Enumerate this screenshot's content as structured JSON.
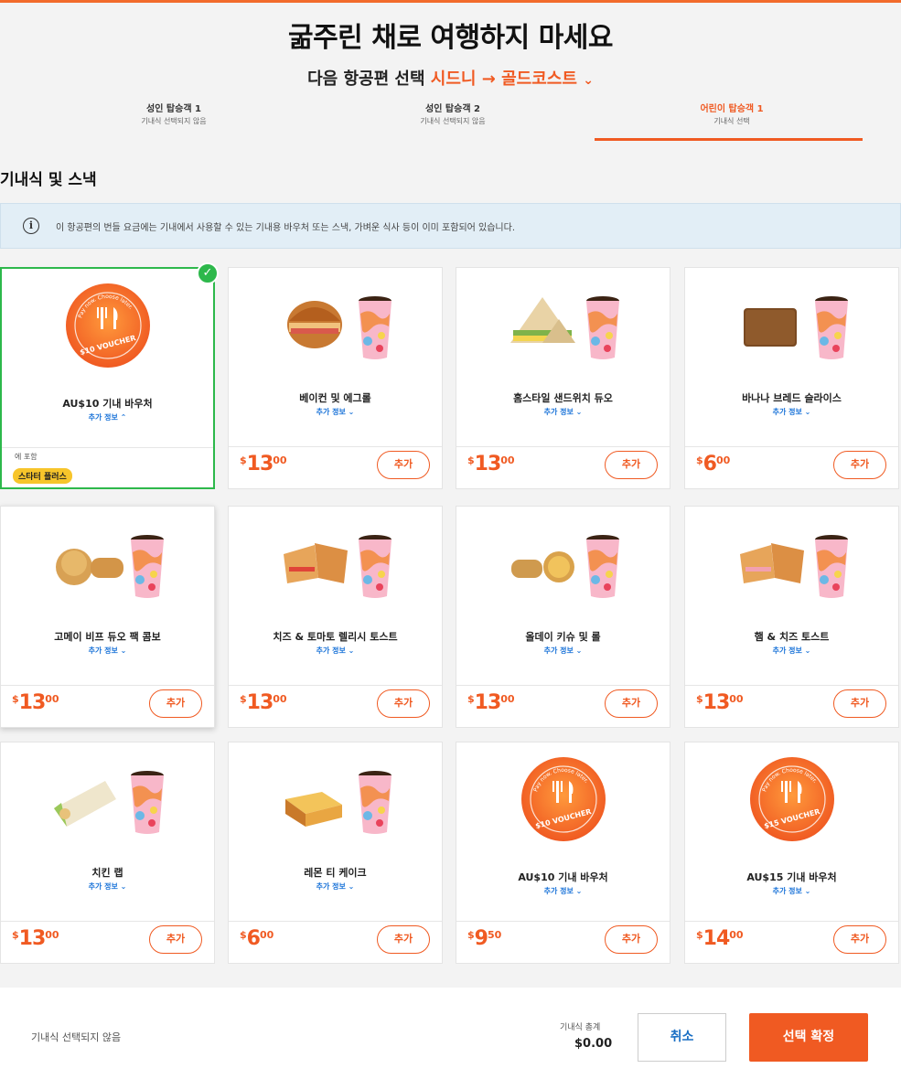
{
  "header": {
    "headline": "굶주린 채로 여행하지 마세요",
    "subhead_prefix": "다음 항공편 선택",
    "route": "시드니 → 골드코스트",
    "route_chevron": "⌄"
  },
  "passengers": [
    {
      "name": "성인 탑승객 1",
      "status": "기내식 선택되지 않음",
      "active": false
    },
    {
      "name": "성인 탑승객 2",
      "status": "기내식 선택되지 않음",
      "active": false
    },
    {
      "name": "어린이 탑승객 1",
      "status": "기내식 선택",
      "active": true
    }
  ],
  "section_title": "기내식 및 스낵",
  "info_bar": {
    "icon": "info-icon",
    "text": "이 항공편의 번들 요금에는 기내에서 사용할 수 있는 기내용 바우처 또는 스낵, 가벼운 식사 등이 이미 포함되어 있습니다."
  },
  "more_info_label": "추가 정보",
  "add_label": "추가",
  "items": [
    {
      "name": "AU$10 기내 바우처",
      "image": "voucher-10",
      "included_label": "에 포함",
      "badge": "스타터 플러스",
      "selected": true
    },
    {
      "name": "베이컨 및 에그롤",
      "image": "bacon-egg-roll",
      "price_cur": "$",
      "price_int": "13",
      "price_dec": "00"
    },
    {
      "name": "홈스타일 샌드위치 듀오",
      "image": "sandwich",
      "price_cur": "$",
      "price_int": "13",
      "price_dec": "00"
    },
    {
      "name": "바나나 브레드 슬라이스",
      "image": "banana-bread",
      "price_cur": "$",
      "price_int": "6",
      "price_dec": "00"
    },
    {
      "name": "고메이 비프 듀오 팩 콤보",
      "image": "beef-pie",
      "price_cur": "$",
      "price_int": "13",
      "price_dec": "00"
    },
    {
      "name": "치즈 & 토마토 렐리시 토스트",
      "image": "toastie",
      "price_cur": "$",
      "price_int": "13",
      "price_dec": "00"
    },
    {
      "name": "올데이 키슈 및 롤",
      "image": "quiche",
      "price_cur": "$",
      "price_int": "13",
      "price_dec": "00"
    },
    {
      "name": "햄 & 치즈 토스트",
      "image": "ham-toastie",
      "price_cur": "$",
      "price_int": "13",
      "price_dec": "00"
    },
    {
      "name": "치킨 랩",
      "image": "wrap",
      "price_cur": "$",
      "price_int": "13",
      "price_dec": "00"
    },
    {
      "name": "레몬 티 케이크",
      "image": "cake",
      "price_cur": "$",
      "price_int": "6",
      "price_dec": "00"
    },
    {
      "name": "AU$10 기내 바우처",
      "image": "voucher-10",
      "price_cur": "$",
      "price_int": "9",
      "price_dec": "50"
    },
    {
      "name": "AU$15 기내 바우처",
      "image": "voucher-15",
      "price_cur": "$",
      "price_int": "14",
      "price_dec": "00"
    }
  ],
  "voucher_text": {
    "ring": "Pay now. Choose later.",
    "v10": "$10 VOUCHER",
    "v15": "$15 VOUCHER"
  },
  "footer": {
    "status": "기내식 선택되지 않음",
    "total_label": "기내식 총계",
    "total_value": "$0.00",
    "cancel_label": "취소",
    "confirm_label": "선택 확정"
  },
  "colors": {
    "accent": "#f05a22",
    "selected": "#2db84b",
    "badge": "#f7c52b",
    "link": "#1a73d8"
  }
}
